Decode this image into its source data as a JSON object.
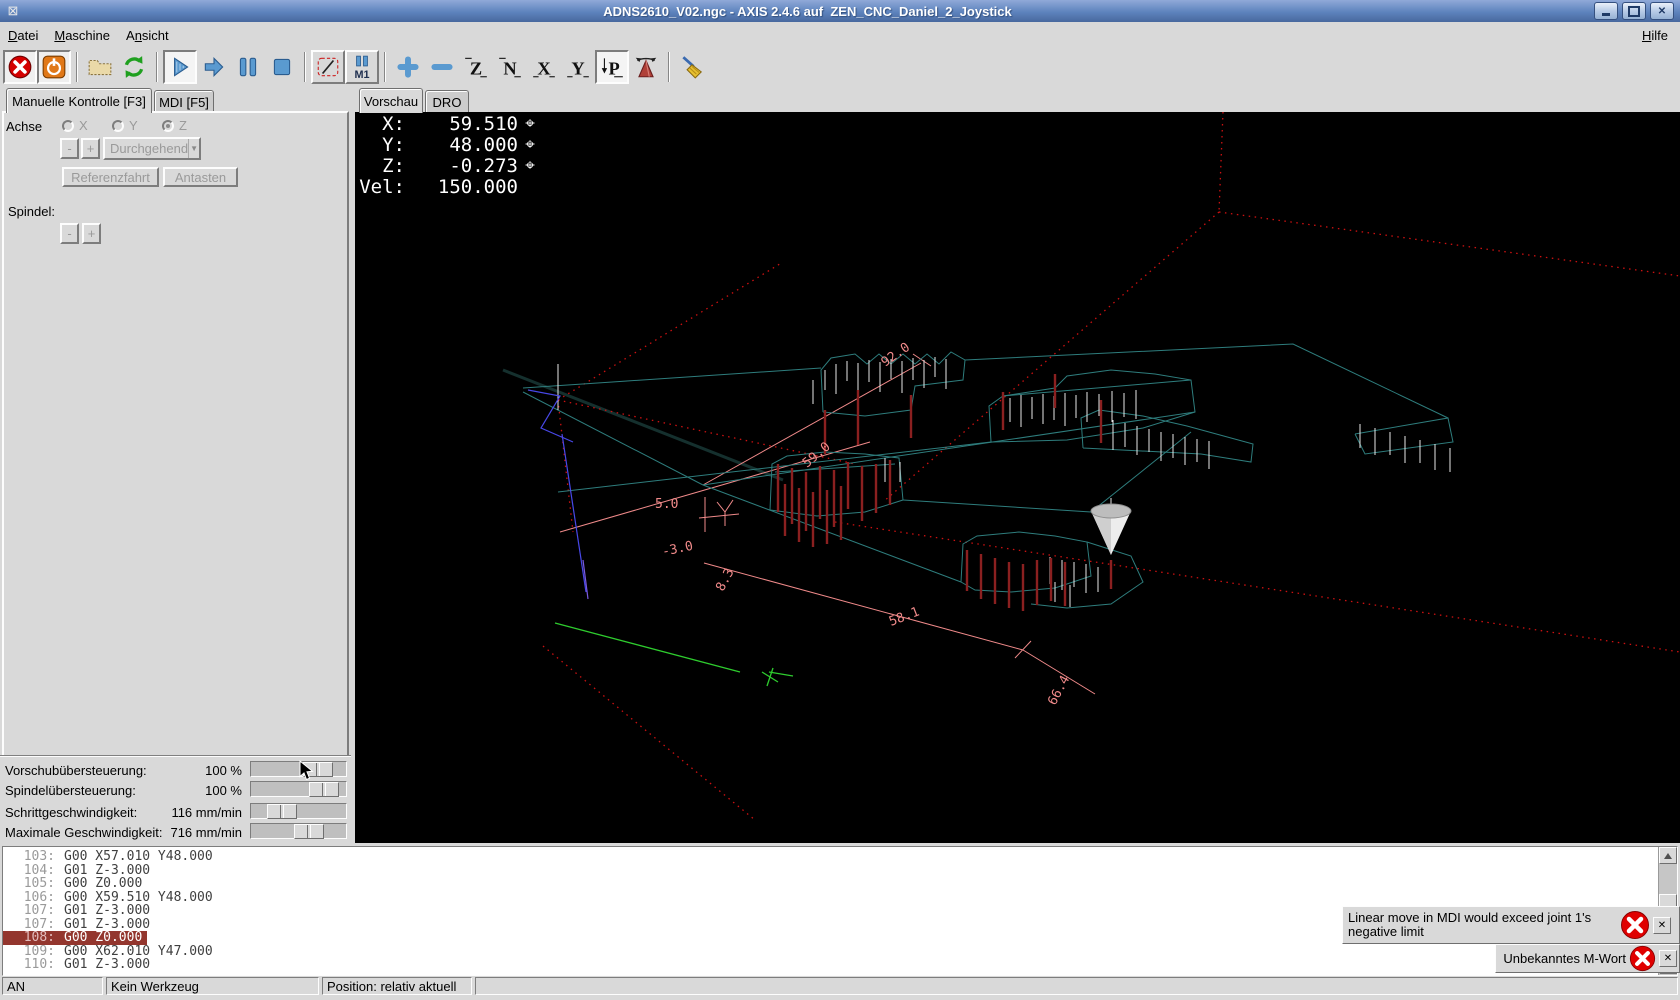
{
  "window": {
    "title": "ADNS2610_V02.ngc - AXIS 2.4.6 auf  ZEN_CNC_Daniel_2_Joystick"
  },
  "menu": {
    "items": [
      {
        "pre": "",
        "u": "D",
        "post": "atei"
      },
      {
        "pre": "",
        "u": "M",
        "post": "aschine"
      },
      {
        "pre": "A",
        "u": "n",
        "post": "sicht"
      },
      {
        "pre": "",
        "u": "H",
        "post": "ilfe"
      }
    ]
  },
  "toolbar": {
    "letters": {
      "z": "Z",
      "z2": "N",
      "x": "X",
      "y": "Y",
      "p": "P",
      "m1": "M1"
    }
  },
  "left_panel": {
    "tabs": [
      {
        "label": "Manuelle Kontrolle [F3]"
      },
      {
        "label": "MDI [F5]"
      }
    ],
    "achse_label": "Achse",
    "axes": [
      {
        "label": "X"
      },
      {
        "label": "Y"
      },
      {
        "label": "Z"
      }
    ],
    "selected_axis": "Z",
    "jog_minus": "-",
    "jog_plus": "+",
    "jog_mode": "Durchgehend",
    "home_button": "Referenzfahrt",
    "probe_button": "Antasten",
    "spindle_label": "Spindel:",
    "spindle_minus": "-",
    "spindle_plus": "+",
    "sliders": [
      {
        "label": "Vorschubübersteuerung:",
        "value": "100 %"
      },
      {
        "label": "Spindelübersteuerung:",
        "value": "100 %"
      },
      {
        "label": "Schrittgeschwindigkeit:",
        "value": "116 mm/min"
      },
      {
        "label": "Maximale Geschwindigkeit:",
        "value": "716 mm/min"
      }
    ]
  },
  "preview": {
    "tabs": [
      {
        "label": "Vorschau"
      },
      {
        "label": "DRO"
      }
    ],
    "dro": {
      "rows": [
        {
          "label": "X:",
          "value": "59.510",
          "homed": "⌖"
        },
        {
          "label": "Y:",
          "value": "48.000",
          "homed": "⌖"
        },
        {
          "label": "Z:",
          "value": "-0.273",
          "homed": "⌖"
        },
        {
          "label": "Vel:",
          "value": "150.000",
          "homed": ""
        }
      ]
    },
    "dims": {
      "d92": "92.0",
      "d59": "59.0",
      "d5": "5.0",
      "dm3": "-3.0",
      "d83": "8.3",
      "d58": "58.1",
      "d66": "66.4"
    }
  },
  "gcode": {
    "lines": [
      {
        "n": "103:",
        "text": "G00 X57.010 Y48.000"
      },
      {
        "n": "104:",
        "text": "G01 Z-3.000"
      },
      {
        "n": "105:",
        "text": "G00 Z0.000"
      },
      {
        "n": "106:",
        "text": "G00 X59.510 Y48.000"
      },
      {
        "n": "107:",
        "text": "G01 Z-3.000"
      },
      {
        "n": "107:",
        "text": "G01 Z-3.000"
      },
      {
        "n": "108:",
        "text": "G00 Z0.000"
      },
      {
        "n": "109:",
        "text": "G00 X62.010 Y47.000"
      },
      {
        "n": "110:",
        "text": "G01 Z-3.000"
      }
    ]
  },
  "notifications": [
    {
      "text": "Linear move in MDI would exceed joint 1's negative limit"
    },
    {
      "text": "Unbekanntes M-Wort"
    }
  ],
  "status_bar": {
    "machine": "AN",
    "tool": "Kein Werkzeug",
    "position": "Position: relativ aktuell"
  },
  "colors": {
    "titlebar": "#5d83bd",
    "feed_path": "#2e7d7d",
    "rapid_limit": "#cc1111",
    "dimension": "#f08a8a",
    "plunge": "#8b2020",
    "highlight_line": "#93362e"
  }
}
